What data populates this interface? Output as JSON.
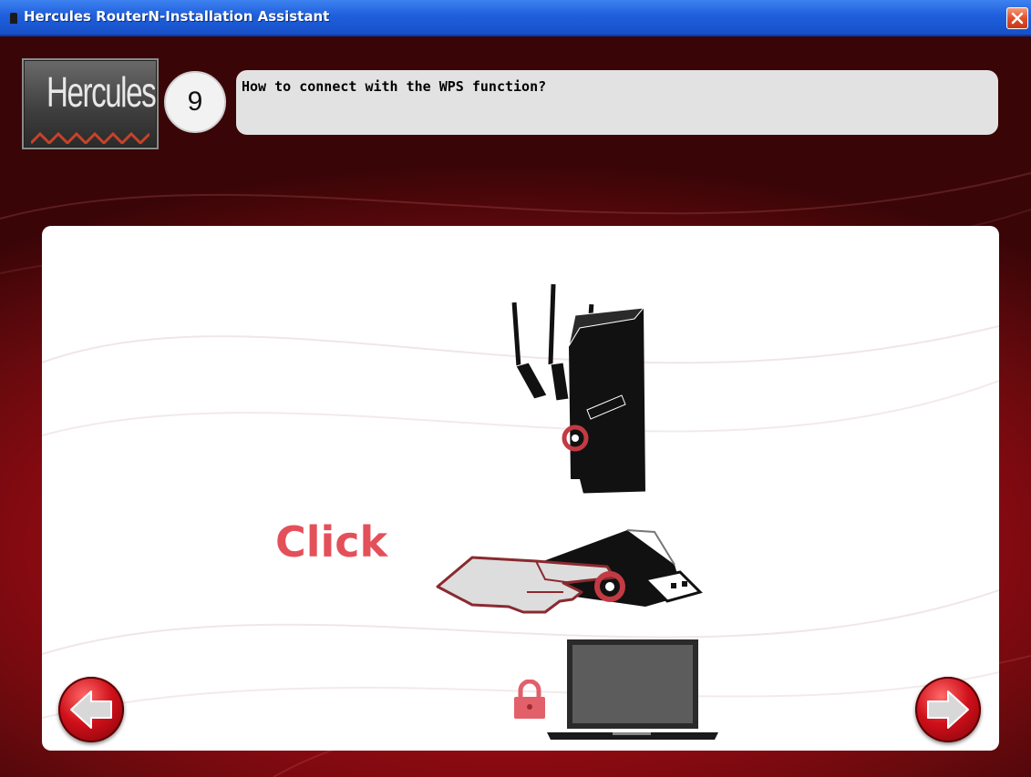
{
  "window": {
    "title": "Hercules RouterN-Installation Assistant",
    "close_icon": "close-icon"
  },
  "header": {
    "logo_text": "Hercules",
    "step_number": "9",
    "question": "How to connect with the WPS function?"
  },
  "content": {
    "click_label": "Click",
    "illustrations": [
      "wireless-router-icon",
      "usb-wifi-adapter-icon",
      "pointing-hand-icon",
      "padlock-icon",
      "laptop-icon"
    ]
  },
  "navigation": {
    "back_icon": "arrow-left-icon",
    "next_icon": "arrow-right-icon"
  },
  "colors": {
    "titlebar": "#1f5fdc",
    "background_red": "#d0101a",
    "accent_red": "#e4505a",
    "panel": "#ffffff"
  }
}
